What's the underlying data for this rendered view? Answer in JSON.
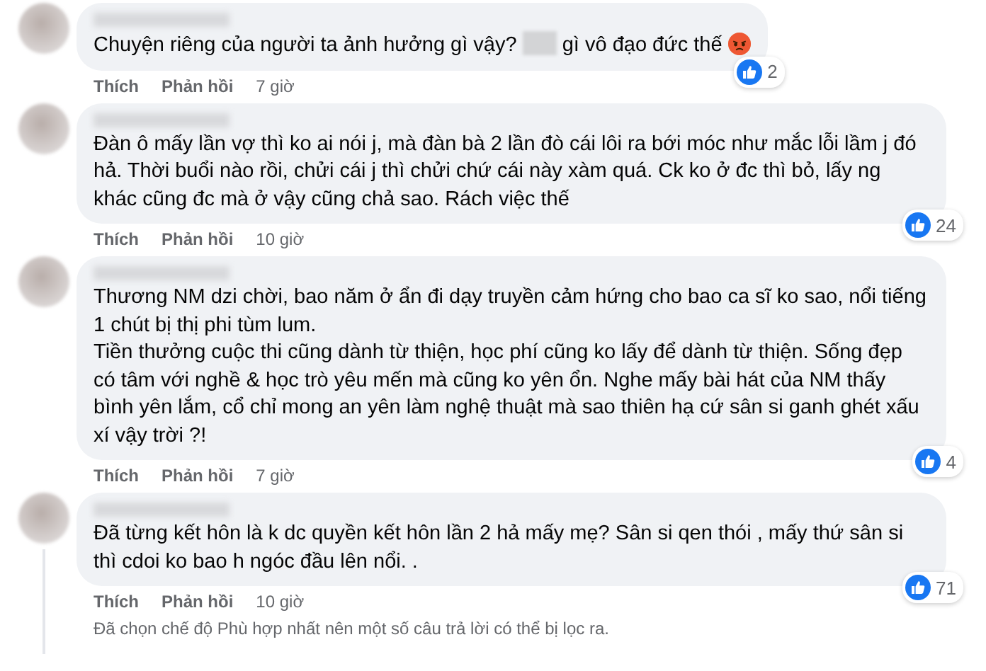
{
  "comments": [
    {
      "paragraphs": [
        [
          {
            "kind": "text",
            "text": "Chuyện riêng của người ta ảnh hưởng gì vậy? "
          },
          {
            "kind": "redacted"
          },
          {
            "kind": "text",
            "text": " gì vô đạo đức thế "
          },
          {
            "kind": "angry"
          }
        ]
      ],
      "actions": [
        "Thích",
        "Phản hồi"
      ],
      "time": "7 giờ",
      "likes": "2",
      "thread": false
    },
    {
      "paragraphs": [
        [
          {
            "kind": "text",
            "text": "Đàn ô mấy lần vợ thì ko ai nói j, mà đàn bà 2 lần đò cái lôi ra bới móc như mắc lỗi lầm j đó hả. Thời buổi nào rồi, chửi cái j thì chửi chứ cái này xàm quá. Ck ko ở đc thì bỏ, lấy ng khác cũng đc mà ở vậy cũng chả sao. Rách việc thế"
          }
        ]
      ],
      "actions": [
        "Thích",
        "Phản hồi"
      ],
      "time": "10 giờ",
      "likes": "24",
      "thread": false
    },
    {
      "paragraphs": [
        [
          {
            "kind": "text",
            "text": "Thương NM dzi chời, bao năm ở ẩn đi dạy truyền cảm hứng cho bao ca sĩ ko sao, nổi tiếng 1 chút bị thị phi tùm lum."
          }
        ],
        [
          {
            "kind": "text",
            "text": "Tiền thưởng cuộc thi cũng dành từ thiện, học phí cũng ko lấy để dành từ thiện. Sống đẹp có tâm với nghề & học trò yêu mến mà cũng ko yên ổn. Nghe mấy bài hát của NM thấy bình yên lắm, cổ chỉ mong an yên làm nghệ thuật mà sao thiên hạ cứ sân si ganh ghét xấu xí vậy trời ?!"
          }
        ]
      ],
      "actions": [
        "Thích",
        "Phản hồi"
      ],
      "time": "7 giờ",
      "likes": "4",
      "thread": false
    },
    {
      "paragraphs": [
        [
          {
            "kind": "text",
            "text": "Đã từng kết hôn là k dc quyền kết hôn lần 2 hả mấy mẹ? Sân si qen thói , mấy thứ sân si thì cdoi ko bao h ngóc đầu lên nổi. ."
          }
        ]
      ],
      "actions": [
        "Thích",
        "Phản hồi"
      ],
      "time": "10 giờ",
      "likes": "71",
      "thread": true
    }
  ],
  "filter_note": "Đã chọn chế độ Phù hợp nhất nên một số câu trả lời có thể bị lọc ra."
}
